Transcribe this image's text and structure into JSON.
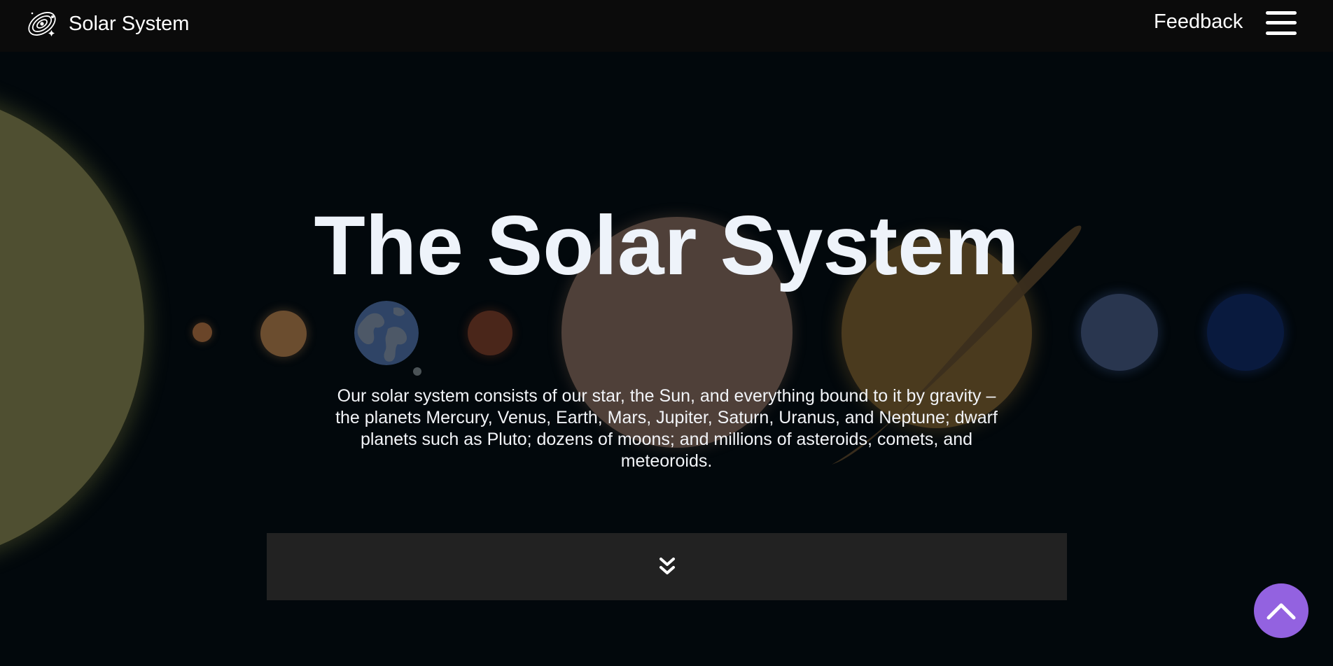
{
  "header": {
    "brand_label": "Solar System",
    "brand_icon": "galaxy-icon",
    "feedback_label": "Feedback",
    "menu_icon": "hamburger-menu-icon"
  },
  "hero": {
    "title": "The Solar System",
    "description": "Our solar system consists of our star, the Sun, and everything bound to it by gravity – the planets Mercury, Venus, Earth, Mars, Jupiter, Saturn, Uranus, and Neptune; dwarf planets such as Pluto; dozens of moons; and millions of asteroids, comets, and meteoroids.",
    "scroll_icon": "chevron-double-down-icon"
  },
  "back_to_top": {
    "icon": "chevron-up-icon",
    "color": "#9362e0"
  },
  "colors": {
    "background": "#02080c",
    "navbar": "#0b0b0b",
    "panel": "#222222"
  }
}
